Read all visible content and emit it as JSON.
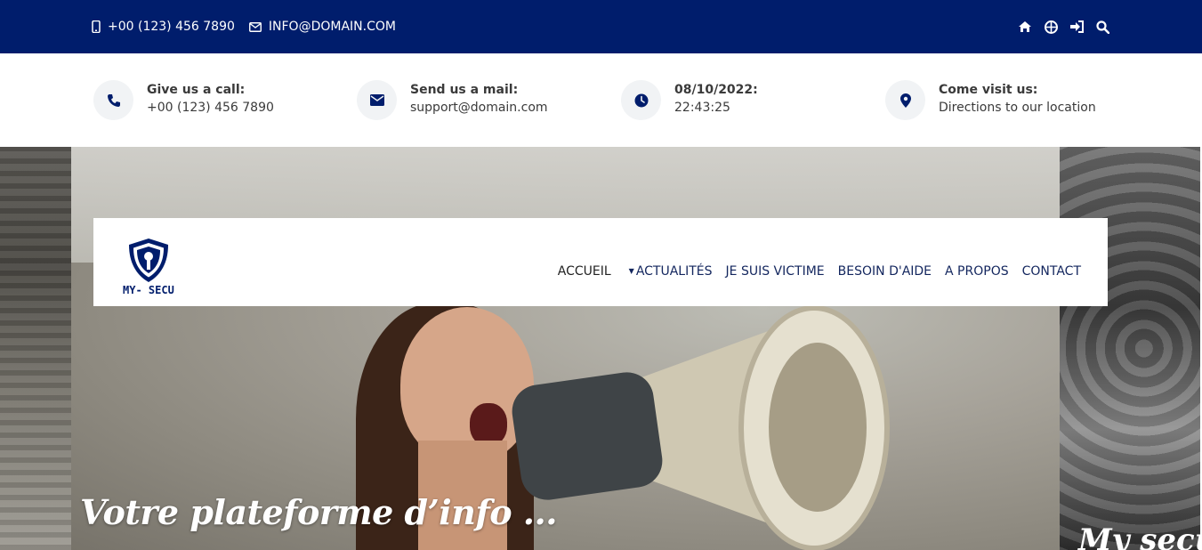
{
  "topbar": {
    "phone": "+00 (123) 456 7890",
    "email": "INFO@DOMAIN.COM",
    "icons": [
      "home-icon",
      "globe-icon",
      "sign-in-icon",
      "search-icon"
    ]
  },
  "info": [
    {
      "icon": "phone-icon",
      "title": "Give us a call:",
      "value": "+00 (123) 456 7890"
    },
    {
      "icon": "envelope-icon",
      "title": "Send us a mail:",
      "value": "support@domain.com"
    },
    {
      "icon": "clock-icon",
      "title": "08/10/2022:",
      "value": "22:43:25"
    },
    {
      "icon": "map-marker-icon",
      "title": "Come visit us:",
      "value": "Directions to our location"
    }
  ],
  "logo": {
    "text": "MY- SECU"
  },
  "nav": {
    "items": [
      "ACCUEIL",
      "ACTUALITÉS",
      "JE SUIS VICTIME",
      "BESOIN D'AIDE",
      "A PROPOS",
      "CONTACT"
    ]
  },
  "hero": {
    "title": "Votre plateforme d’info ...",
    "next_title": "My secu"
  },
  "colors": {
    "brand": "#001d6c",
    "icon_bg": "#f1f3f5"
  }
}
